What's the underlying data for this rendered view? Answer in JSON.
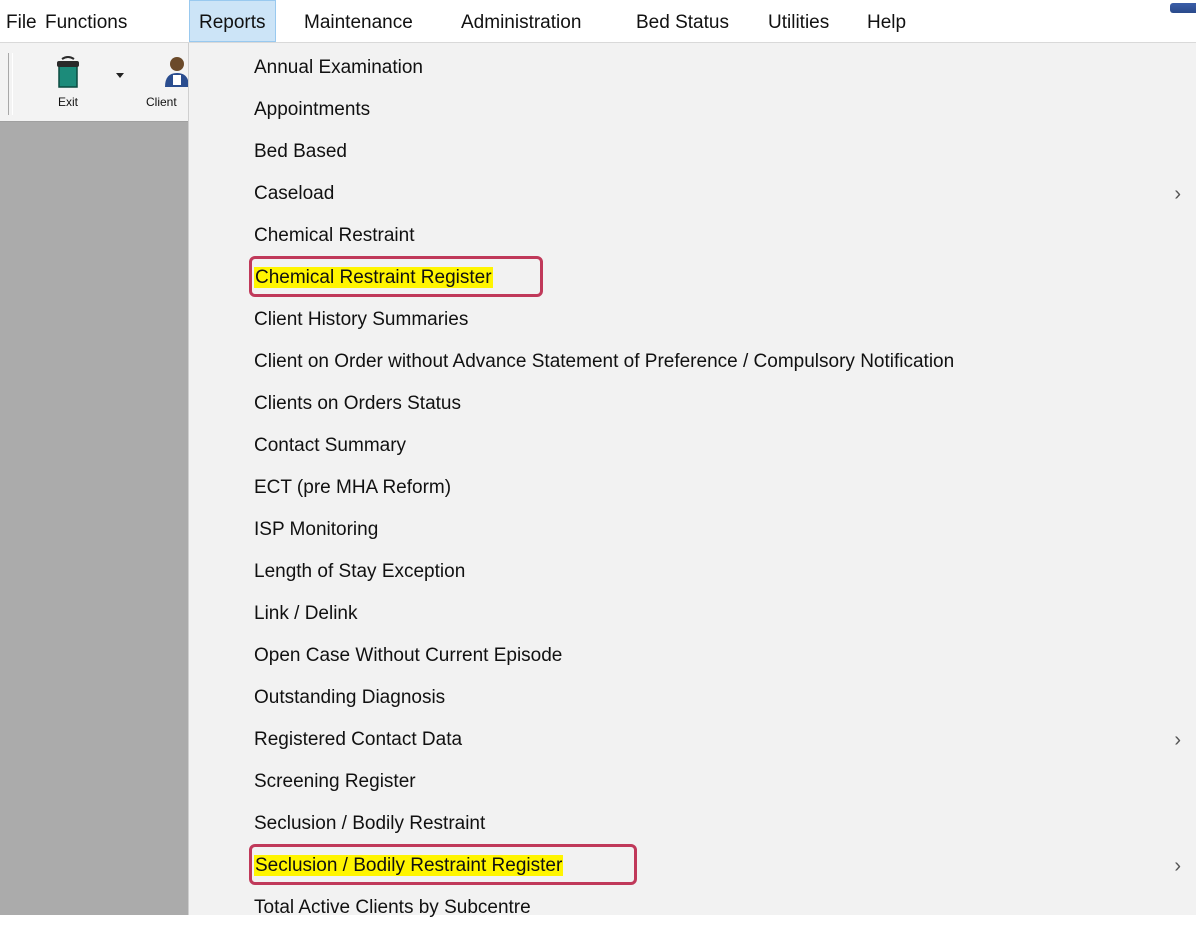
{
  "menubar": {
    "items": [
      {
        "label": "File"
      },
      {
        "label": "Functions"
      },
      {
        "label": "Reports",
        "active": true
      },
      {
        "label": "Maintenance"
      },
      {
        "label": "Administration"
      },
      {
        "label": "Bed Status"
      },
      {
        "label": "Utilities"
      },
      {
        "label": "Help"
      }
    ]
  },
  "toolbar": {
    "exit_label": "Exit",
    "exit_icon": "exit-door-icon",
    "client_label": "Client",
    "client_icon": "client-person-icon",
    "dropdown_icon": "chevron-down-icon"
  },
  "reports_menu": {
    "items": [
      {
        "label": "Annual Examination"
      },
      {
        "label": "Appointments"
      },
      {
        "label": "Bed Based"
      },
      {
        "label": "Caseload",
        "submenu": true
      },
      {
        "label": "Chemical Restraint"
      },
      {
        "label": "Chemical Restraint Register",
        "highlighted": true
      },
      {
        "label": "Client History Summaries"
      },
      {
        "label": "Client on Order without Advance Statement of Preference / Compulsory Notification"
      },
      {
        "label": "Clients on Orders Status"
      },
      {
        "label": "Contact Summary"
      },
      {
        "label": "ECT (pre MHA Reform)"
      },
      {
        "label": "ISP Monitoring"
      },
      {
        "label": "Length of Stay Exception"
      },
      {
        "label": "Link / Delink"
      },
      {
        "label": "Open Case Without Current Episode"
      },
      {
        "label": "Outstanding Diagnosis"
      },
      {
        "label": "Registered Contact Data",
        "submenu": true
      },
      {
        "label": "Screening Register"
      },
      {
        "label": "Seclusion / Bodily Restraint"
      },
      {
        "label": "Seclusion / Bodily Restraint Register",
        "highlighted": true,
        "submenu": true
      },
      {
        "label": "Total Active Clients by Subcentre"
      }
    ],
    "submenu_arrow": "›",
    "highlight_color": "#fff500",
    "annotation_ring_color": "#c0395a"
  }
}
